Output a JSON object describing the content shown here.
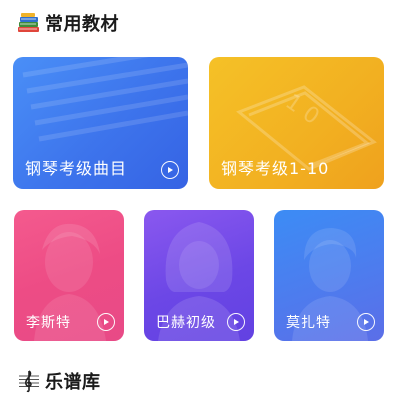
{
  "sections": {
    "textbooks": {
      "title": "常用教材",
      "icon": "books-icon"
    },
    "library": {
      "title": "乐谱库",
      "icon": "treble-clef-icon"
    }
  },
  "cards": [
    {
      "label": "钢琴考级曲目",
      "color": "#3d74ec"
    },
    {
      "label": "钢琴考级1-10",
      "color": "#f2b021"
    },
    {
      "label": "李斯特",
      "color": "#ed4c85"
    },
    {
      "label": "巴赫初级",
      "color": "#6c47e6"
    },
    {
      "label": "莫扎特",
      "color": "#4d7cee"
    }
  ]
}
